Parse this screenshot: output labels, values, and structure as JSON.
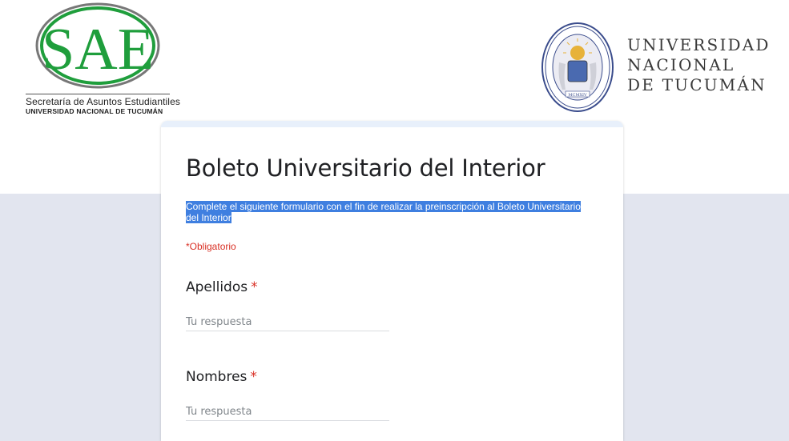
{
  "header": {
    "sae": {
      "logo_text": "SAE",
      "subtitle": "Secretaría de Asuntos Estudiantiles",
      "institution": "UNIVERSIDAD NACIONAL DE TUCUMÁN",
      "color": "#1f9e3c"
    },
    "unt": {
      "seal_year": "MCMXIV",
      "name_lines": [
        "UNIVERSIDAD",
        "NACIONAL",
        "DE TUCUMÁN"
      ],
      "color": "#3a4c8c"
    }
  },
  "form": {
    "title": "Boleto Universitario del Interior",
    "description": "Complete el siguiente formulario con el fin de realizar la preinscripción al Boleto Universitario del Interior",
    "required_note": "*Obligatorio",
    "questions": [
      {
        "label": "Apellidos",
        "required_mark": "*",
        "placeholder": "Tu respuesta",
        "value": ""
      },
      {
        "label": "Nombres",
        "required_mark": "*",
        "placeholder": "Tu respuesta",
        "value": ""
      }
    ]
  },
  "colors": {
    "page_background": "#e2e5ef",
    "selection_highlight": "#3f7fe0",
    "required": "#d93025",
    "accent_strip": "#e8f0fb"
  }
}
